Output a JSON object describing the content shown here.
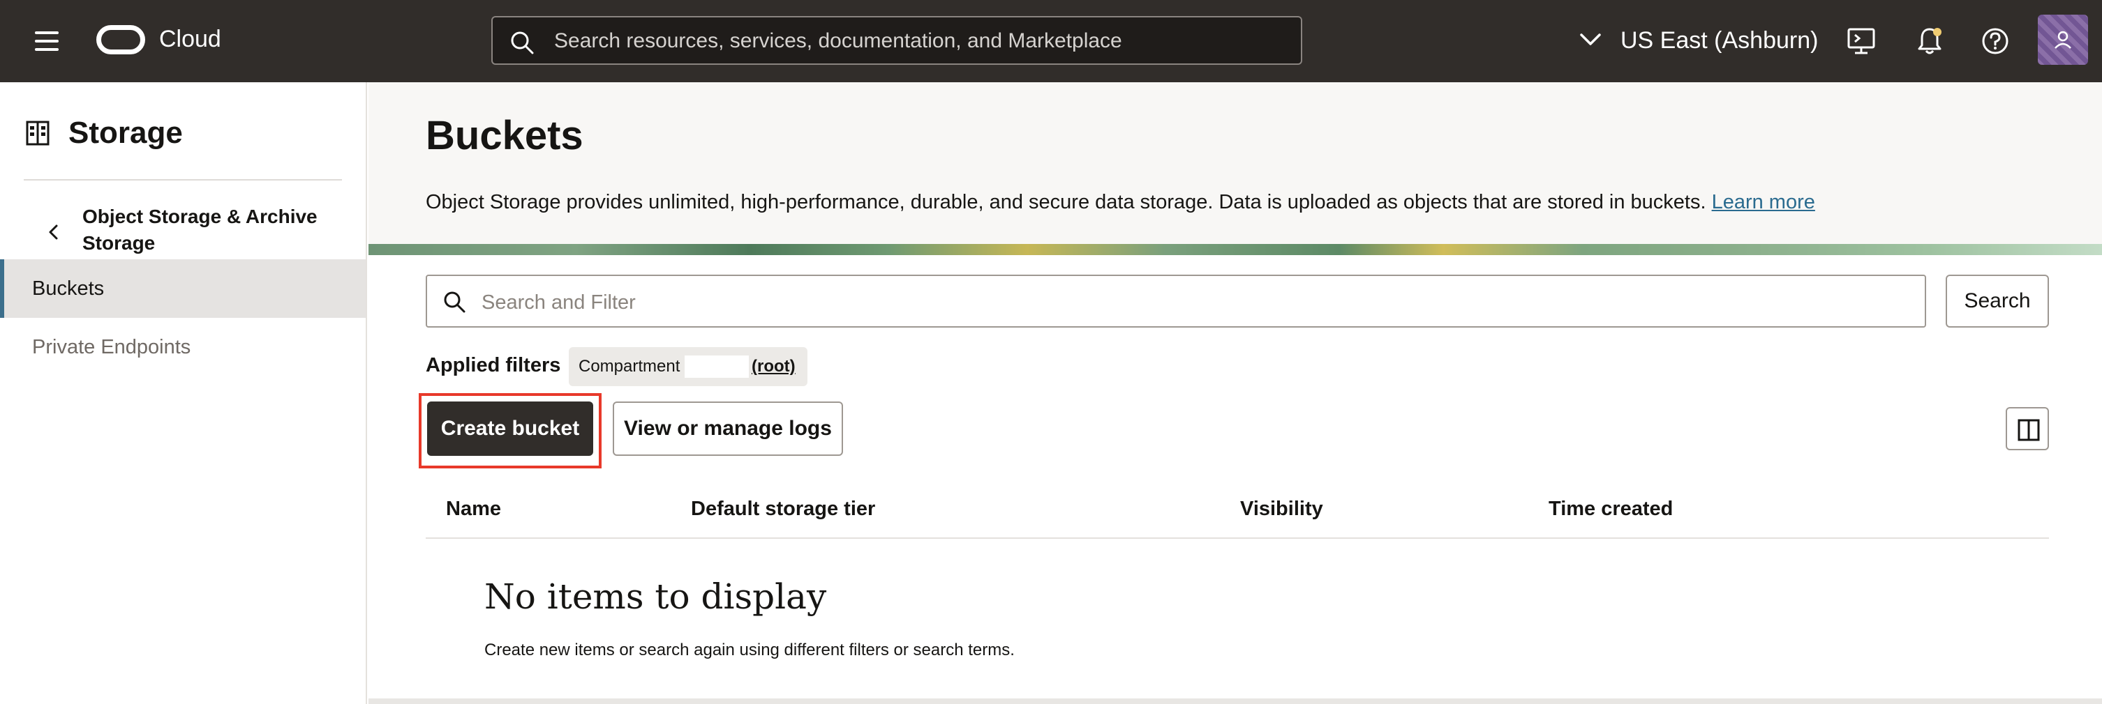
{
  "header": {
    "brand": "Cloud",
    "search_placeholder": "Search resources, services, documentation, and Marketplace",
    "region": "US East (Ashburn)",
    "icons": [
      "menu-icon",
      "oracle-logo",
      "search-icon",
      "chevron-down-icon",
      "cloud-shell-icon",
      "bell-icon",
      "help-icon",
      "user-icon"
    ],
    "colors": {
      "background": "#312d2a",
      "notification_dot": "#f0cc71"
    }
  },
  "sidebar": {
    "title": "Storage",
    "parent_link": "Object Storage & Archive Storage",
    "items": [
      {
        "label": "Buckets",
        "active": true
      },
      {
        "label": "Private Endpoints",
        "active": false
      }
    ]
  },
  "main": {
    "title": "Buckets",
    "description": "Object Storage provides unlimited, high-performance, durable, and secure data storage. Data is uploaded as objects that are stored in buckets.",
    "learn_more": "Learn more",
    "filter_placeholder": "Search and Filter",
    "search_button": "Search",
    "applied_filters_label": "Applied filters",
    "filter_chip": {
      "key": "Compartment",
      "value": "(root)"
    },
    "create_button": "Create bucket",
    "logs_button": "View or manage logs",
    "table_headers": [
      "Name",
      "Default storage tier",
      "Visibility",
      "Time created"
    ],
    "empty_title": "No items to display",
    "empty_subtitle": "Create new items or search again using different filters or search terms.",
    "colors": {
      "primary_button": "#312d2a",
      "highlight_outline": "#e8392a",
      "link": "#2a6b8f",
      "active_nav_border": "#3c6f8c"
    }
  }
}
